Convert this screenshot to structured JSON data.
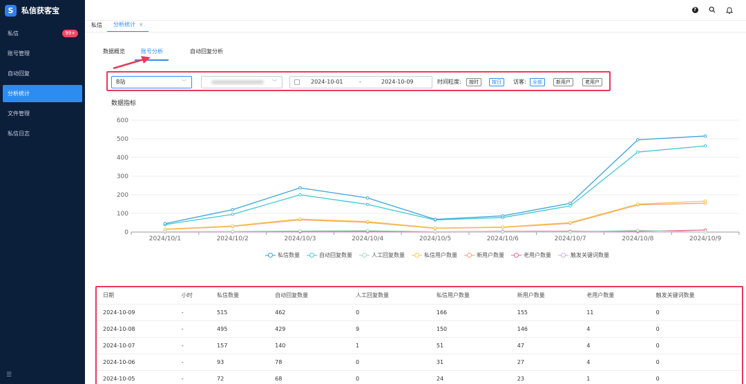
{
  "app": {
    "name": "私信获客宝",
    "logo_letter": "S"
  },
  "sidebar": {
    "items": [
      {
        "label": "私信",
        "badge": "99+"
      },
      {
        "label": "账号管理"
      },
      {
        "label": "自动回复"
      },
      {
        "label": "分析统计",
        "active": true
      },
      {
        "label": "文件管理"
      },
      {
        "label": "私信日志"
      }
    ]
  },
  "topbar": {
    "icons": [
      "help-icon",
      "search-icon",
      "bell-icon"
    ]
  },
  "page_tabs": [
    {
      "label": "私信"
    },
    {
      "label": "分析统计",
      "active": true,
      "closable": true
    }
  ],
  "sub_tabs": [
    {
      "label": "数据概览"
    },
    {
      "label": "账号分析",
      "active": true
    },
    {
      "label": "自动回复分析"
    }
  ],
  "filters": {
    "platform": "B站",
    "date_start": "2024-10-01",
    "date_sep": "-",
    "date_end": "2024-10-09",
    "granularity_label": "时间粒度:",
    "granularity_options": [
      "按时",
      "按日"
    ],
    "granularity_selected": "按日",
    "visitor_label": "访客:",
    "visitor_options": [
      "全部",
      "新用户",
      "老用户"
    ],
    "visitor_selected": "全部"
  },
  "chart": {
    "title": "数据指标"
  },
  "chart_data": {
    "type": "line",
    "title": "数据指标",
    "x": [
      "2024/10/1",
      "2024/10/2",
      "2024/10/3",
      "2024/10/4",
      "2024/10/5",
      "2024/10/6",
      "2024/10/7",
      "2024/10/8",
      "2024/10/9"
    ],
    "ylim": [
      0,
      600
    ],
    "yticks": [
      0,
      100,
      200,
      300,
      400,
      500,
      600
    ],
    "grid": "horizontal",
    "legend_position": "bottom",
    "series": [
      {
        "name": "私信数量",
        "color": "#3ba1d9",
        "values": [
          45,
          120,
          237,
          183,
          68,
          87,
          154,
          495,
          515
        ]
      },
      {
        "name": "自动回复数量",
        "color": "#3ec7d3",
        "values": [
          40,
          95,
          200,
          148,
          65,
          78,
          140,
          429,
          462
        ]
      },
      {
        "name": "人工回复数量",
        "color": "#a0dbb4",
        "values": [
          2,
          3,
          6,
          8,
          2,
          2,
          1,
          9,
          0
        ]
      },
      {
        "name": "私信用户数量",
        "color": "#f5c84c",
        "values": [
          16,
          33,
          70,
          56,
          22,
          27,
          51,
          150,
          166
        ]
      },
      {
        "name": "新用户数量",
        "color": "#f5a16b",
        "values": [
          14,
          30,
          66,
          52,
          20,
          25,
          47,
          146,
          155
        ]
      },
      {
        "name": "老用户数量",
        "color": "#ea6a8a",
        "values": [
          1,
          2,
          3,
          3,
          1,
          4,
          4,
          4,
          11
        ]
      },
      {
        "name": "触发关键词数量",
        "color": "#d6a8e6",
        "values": [
          0,
          0,
          0,
          0,
          0,
          0,
          0,
          0,
          0
        ]
      }
    ]
  },
  "table": {
    "headers": [
      "日期",
      "小时",
      "私信数量",
      "自动回复数量",
      "人工回复数量",
      "私信用户数量",
      "新用户数量",
      "老用户数量",
      "触发关键词数量"
    ],
    "rows": [
      [
        "2024-10-09",
        "-",
        "515",
        "462",
        "0",
        "166",
        "155",
        "11",
        "0"
      ],
      [
        "2024-10-08",
        "-",
        "495",
        "429",
        "9",
        "150",
        "146",
        "4",
        "0"
      ],
      [
        "2024-10-07",
        "-",
        "157",
        "140",
        "1",
        "51",
        "47",
        "4",
        "0"
      ],
      [
        "2024-10-06",
        "-",
        "93",
        "78",
        "0",
        "31",
        "27",
        "4",
        "0"
      ],
      [
        "2024-10-05",
        "-",
        "72",
        "68",
        "0",
        "24",
        "23",
        "1",
        "0"
      ]
    ]
  }
}
